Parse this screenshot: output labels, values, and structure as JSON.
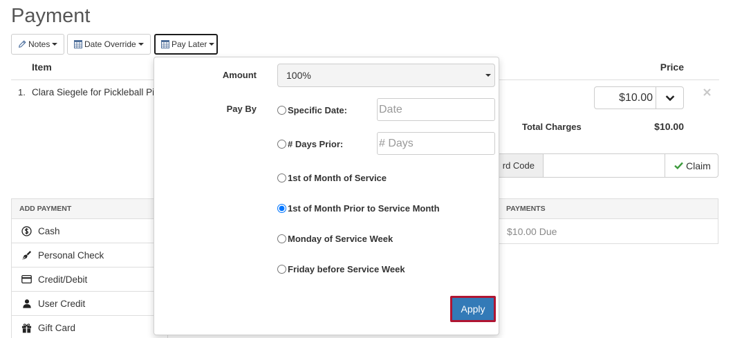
{
  "page": {
    "title": "Payment"
  },
  "toolbar": {
    "notes": {
      "label": "Notes",
      "icon": "pencil-icon"
    },
    "date_override": {
      "label": "Date Override",
      "icon": "calendar-icon"
    },
    "pay_later": {
      "label": "Pay Later",
      "icon": "calendar-icon",
      "active": true
    }
  },
  "items_table": {
    "headers": {
      "item": "Item",
      "price": "Price"
    },
    "rows": [
      {
        "number": "1.",
        "description": "Clara Siegele for Pickleball Pi",
        "price": "$10.00"
      }
    ],
    "total_label": "Total Charges",
    "total_value": "$10.00"
  },
  "gift_card_code": {
    "label": "rd Code",
    "value": "",
    "claim_label": "Claim",
    "claim_icon": "check-icon"
  },
  "add_payment": {
    "header": "ADD PAYMENT",
    "methods": [
      {
        "label": "Cash",
        "icon": "dollar-circle-icon"
      },
      {
        "label": "Personal Check",
        "icon": "pen-icon"
      },
      {
        "label": "Credit/Debit",
        "icon": "credit-card-icon"
      },
      {
        "label": "User Credit",
        "icon": "user-icon"
      },
      {
        "label": "Gift Card",
        "icon": "gift-icon"
      }
    ]
  },
  "payments": {
    "header": "PAYMENTS",
    "status": "$10.00 Due"
  },
  "pay_later_popup": {
    "amount_label": "Amount",
    "amount_value": "100%",
    "pay_by_label": "Pay By",
    "options": [
      {
        "label": "Specific Date:",
        "checked": false,
        "input_placeholder": "Date"
      },
      {
        "label": "# Days Prior:",
        "checked": false,
        "input_placeholder": "# Days"
      },
      {
        "label": "1st of Month of Service",
        "checked": false
      },
      {
        "label": "1st of Month Prior to Service Month",
        "checked": true
      },
      {
        "label": "Monday of Service Week",
        "checked": false
      },
      {
        "label": "Friday before Service Week",
        "checked": false
      }
    ],
    "apply_label": "Apply"
  },
  "colors": {
    "apply_button": "#337ab7",
    "highlight_border": "#b01532",
    "claim_check": "#3c9a3c",
    "due_text": "#888888"
  }
}
